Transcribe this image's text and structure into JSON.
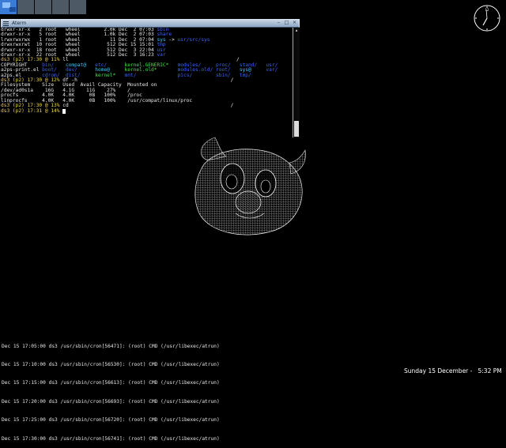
{
  "pager": {
    "workspaces": 5,
    "active_index": 0
  },
  "clock": {
    "marker": "12"
  },
  "xterm": {
    "title": "Aterm",
    "menu_icon": "menu-icon",
    "controls": [
      "minimize",
      "maximize",
      "close"
    ],
    "lines": [
      [
        {
          "t": "drwxr-xr-x   2 root   wheel        2.0k Dec  2 07:03 "
        },
        {
          "t": "sbin",
          "c": "dir"
        }
      ],
      [
        {
          "t": "drwxr-xr-x   5 root   wheel        1.0k Dec  2 07:03 "
        },
        {
          "t": "share",
          "c": "dir"
        }
      ],
      [
        {
          "t": "lrwxrwxrwx   1 root   wheel          11 Dec  2 07:04 "
        },
        {
          "t": "sys",
          "c": "link"
        },
        {
          "t": " -> "
        },
        {
          "t": "usr/src/sys",
          "c": "dir"
        }
      ],
      [
        {
          "t": "drwxrwxrwt  10 root   wheel         512 Dec 15 15:01 "
        },
        {
          "t": "tmp",
          "c": "dir"
        }
      ],
      [
        {
          "t": "drwxr-xr-x  18 root   wheel         512 Dec  3 22:04 "
        },
        {
          "t": "usr",
          "c": "dir"
        }
      ],
      [
        {
          "t": "drwxr-xr-x  22 root   wheel         512 Dec  3 16:23 "
        },
        {
          "t": "var",
          "c": "dir"
        }
      ],
      [
        {
          "t": "ds3 (p2) 17:30 @ 11% ",
          "c": "prompt"
        },
        {
          "t": "ll"
        },
        {
          "t": "                                                         /"
        }
      ],
      [
        {
          "t": "COPYRIGHT     "
        },
        {
          "t": "bin/",
          "c": "dir"
        },
        {
          "t": "    "
        },
        {
          "t": "compat@",
          "c": "link"
        },
        {
          "t": "   "
        },
        {
          "t": "etc/",
          "c": "dir"
        },
        {
          "t": "      "
        },
        {
          "t": "kernel.GENERIC*",
          "c": "exec"
        },
        {
          "t": "   "
        },
        {
          "t": "modules/",
          "c": "dir"
        },
        {
          "t": "     "
        },
        {
          "t": "proc/",
          "c": "dir"
        },
        {
          "t": "   "
        },
        {
          "t": "stand/",
          "c": "dir"
        },
        {
          "t": "   "
        },
        {
          "t": "usr/",
          "c": "dir"
        }
      ],
      [
        {
          "t": "a2ps-print.el "
        },
        {
          "t": "boot/",
          "c": "dir"
        },
        {
          "t": "   "
        },
        {
          "t": "dev/",
          "c": "dir"
        },
        {
          "t": "      "
        },
        {
          "t": "home@",
          "c": "link"
        },
        {
          "t": "     "
        },
        {
          "t": "kernel.old*",
          "c": "exec"
        },
        {
          "t": "       "
        },
        {
          "t": "modules.old/",
          "c": "dir"
        },
        {
          "t": " "
        },
        {
          "t": "root/",
          "c": "dir"
        },
        {
          "t": "   "
        },
        {
          "t": "sys@",
          "c": "link"
        },
        {
          "t": "     "
        },
        {
          "t": "var/",
          "c": "dir"
        }
      ],
      [
        {
          "t": "a2ps.el       "
        },
        {
          "t": "cdrom/",
          "c": "dir"
        },
        {
          "t": "  "
        },
        {
          "t": "dist/",
          "c": "dir"
        },
        {
          "t": "     "
        },
        {
          "t": "kernel*",
          "c": "exec"
        },
        {
          "t": "   "
        },
        {
          "t": "mnt/",
          "c": "dir"
        },
        {
          "t": "              "
        },
        {
          "t": "pics/",
          "c": "dir"
        },
        {
          "t": "        "
        },
        {
          "t": "sbin/",
          "c": "dir"
        },
        {
          "t": "   "
        },
        {
          "t": "tmp/",
          "c": "dir"
        }
      ],
      [
        {
          "t": "ds3 (p2) 17:30 @ 12% ",
          "c": "prompt"
        },
        {
          "t": "df -h"
        },
        {
          "t": "                                                    /"
        }
      ],
      [
        {
          "t": "Filesystem    Size   Used  Avail Capacity  Mounted on"
        }
      ],
      [
        {
          "t": "/dev/ad0s1a    16G   4.1G    11G    27%    /"
        }
      ],
      [
        {
          "t": "procfs        4.0K   4.0K     0B   100%    /proc"
        }
      ],
      [
        {
          "t": "linprocfs     4.0K   4.0K     0B   100%    /usr/compat/linux/proc"
        }
      ],
      [
        {
          "t": "ds3 (p2) 17:30 @ 13% ",
          "c": "prompt"
        },
        {
          "t": "cd"
        },
        {
          "t": "                                                       /"
        }
      ],
      [
        {
          "t": "ds3 (p2) 17:31 @ 14% ",
          "c": "prompt"
        },
        {
          "t": "",
          "cursor": true
        }
      ]
    ]
  },
  "ghost": {
    "name": "wireframe-ghost"
  },
  "log": [
    "Dec 15 17:05:00 ds3 /usr/sbin/cron[56471]: (root) CMD (/usr/libexec/atrun)",
    "Dec 15 17:10:00 ds3 /usr/sbin/cron[56530]: (root) CMD (/usr/libexec/atrun)",
    "Dec 15 17:15:00 ds3 /usr/sbin/cron[56613]: (root) CMD (/usr/libexec/atrun)",
    "Dec 15 17:20:00 ds3 /usr/sbin/cron[56693]: (root) CMD (/usr/libexec/atrun)",
    "Dec 15 17:25:00 ds3 /usr/sbin/cron[56720]: (root) CMD (/usr/libexec/atrun)",
    "Dec 15 17:30:00 ds3 /usr/sbin/cron[56741]: (root) CMD (/usr/libexec/atrun)"
  ],
  "datetime": "Sunday 15 December -   5:32 PM",
  "colors": {
    "prompt": "#f1d44a",
    "dir": "#3d62ff",
    "link": "#38c8ff",
    "exec": "#42e04a",
    "titlebar": "#8ea6c2"
  }
}
